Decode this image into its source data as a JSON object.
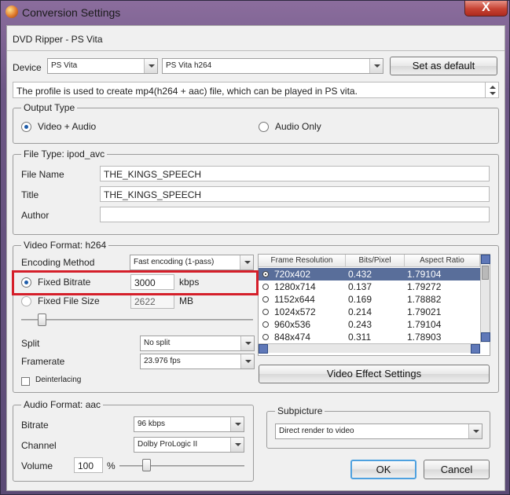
{
  "window": {
    "title": "Conversion Settings",
    "close_label": "X",
    "profile_name": "DVD Ripper - PS Vita"
  },
  "device": {
    "label": "Device",
    "value": "PS Vita",
    "profile": "PS Vita h264",
    "set_default_label": "Set as default",
    "description": "The profile is used to create mp4(h264 + aac) file, which can be played in PS vita."
  },
  "output_type": {
    "legend": "Output Type",
    "video_audio_label": "Video + Audio",
    "audio_only_label": "Audio Only"
  },
  "file_type": {
    "legend": "File Type: ipod_avc",
    "file_name_label": "File Name",
    "file_name_value": "THE_KINGS_SPEECH",
    "title_label": "Title",
    "title_value": "THE_KINGS_SPEECH",
    "author_label": "Author",
    "author_value": ""
  },
  "video": {
    "legend": "Video Format: h264",
    "encoding_label": "Encoding Method",
    "encoding_value": "Fast encoding (1-pass)",
    "fixed_bitrate_label": "Fixed Bitrate",
    "bitrate_value": "3000",
    "bitrate_unit": "kbps",
    "fixed_file_size_label": "Fixed File Size",
    "file_size_value": "2622",
    "file_size_unit": "MB",
    "split_label": "Split",
    "split_value": "No split",
    "framerate_label": "Framerate",
    "framerate_value": "23.976 fps",
    "deinterlacing_label": "Deinterlacing",
    "effect_button_label": "Video Effect Settings"
  },
  "resolution_table": {
    "headers": [
      "Frame Resolution",
      "Bits/Pixel",
      "Aspect Ratio"
    ],
    "rows": [
      {
        "res": "720x402",
        "bpp": "0.432",
        "ratio": "1.79104"
      },
      {
        "res": "1280x714",
        "bpp": "0.137",
        "ratio": "1.79272"
      },
      {
        "res": "1152x644",
        "bpp": "0.169",
        "ratio": "1.78882"
      },
      {
        "res": "1024x572",
        "bpp": "0.214",
        "ratio": "1.79021"
      },
      {
        "res": "960x536",
        "bpp": "0.243",
        "ratio": "1.79104"
      },
      {
        "res": "848x474",
        "bpp": "0.311",
        "ratio": "1.78903"
      }
    ]
  },
  "audio": {
    "legend": "Audio Format: aac",
    "bitrate_label": "Bitrate",
    "bitrate_value": "96 kbps",
    "channel_label": "Channel",
    "channel_value": "Dolby ProLogic II",
    "volume_label": "Volume",
    "volume_value": "100",
    "volume_unit": "%"
  },
  "subpicture": {
    "legend": "Subpicture",
    "value": "Direct render to video"
  },
  "buttons": {
    "ok_label": "OK",
    "cancel_label": "Cancel"
  }
}
